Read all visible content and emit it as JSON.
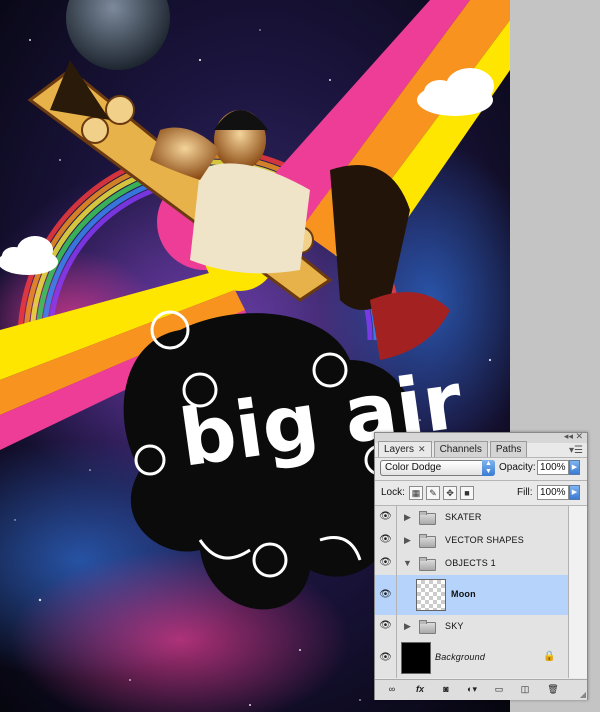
{
  "artwork": {
    "title_text": "big air"
  },
  "layers_panel": {
    "tabs": [
      {
        "label": "Layers",
        "active": true
      },
      {
        "label": "Channels",
        "active": false
      },
      {
        "label": "Paths",
        "active": false
      }
    ],
    "tab_close_glyph": "✕",
    "menu_glyph": "▾☰",
    "blend_mode": "Color Dodge",
    "opacity_label": "Opacity:",
    "opacity_value": "100%",
    "lock_label": "Lock:",
    "fill_label": "Fill:",
    "fill_value": "100%",
    "layers": [
      {
        "name": "SKATER",
        "type": "group",
        "expanded": false,
        "visible": true,
        "selected": false
      },
      {
        "name": "VECTOR SHAPES",
        "type": "group",
        "expanded": false,
        "visible": true,
        "selected": false
      },
      {
        "name": "OBJECTS 1",
        "type": "group",
        "expanded": true,
        "visible": true,
        "selected": false
      },
      {
        "name": "Moon",
        "type": "layer",
        "visible": true,
        "selected": true
      },
      {
        "name": "SKY",
        "type": "group",
        "expanded": false,
        "visible": true,
        "selected": false
      },
      {
        "name": "Background",
        "type": "background",
        "visible": true,
        "selected": false,
        "locked": true
      }
    ],
    "bottom_buttons": [
      "link-layers-icon",
      "fx-icon",
      "layer-mask-icon",
      "adjustment-layer-icon",
      "new-group-icon",
      "new-layer-icon",
      "trash-icon"
    ],
    "fx_label": "fx"
  },
  "colors": {
    "selection": "#b6d3fb",
    "accent": "#3a7bd5",
    "stripe_pink": "#ee3d96",
    "stripe_orange": "#f7931e",
    "stripe_yellow": "#ffe600"
  }
}
